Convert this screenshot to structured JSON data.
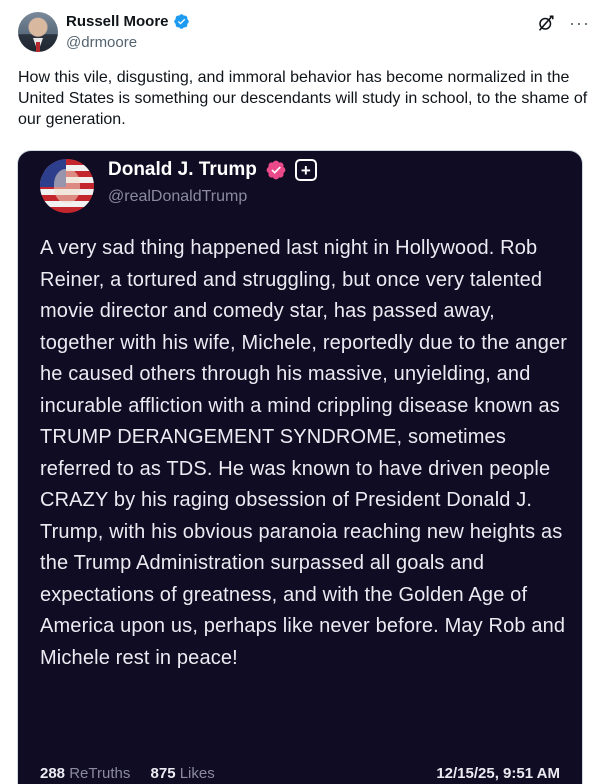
{
  "author": {
    "name": "Russell Moore",
    "handle": "@drmoore",
    "avatar_icon": "profile-photo",
    "verified_icon": "verified-badge-icon",
    "verified_color": "#1d9bf0"
  },
  "actions": {
    "grok_icon": "grok-icon",
    "more_label": "···"
  },
  "tweet": {
    "text": "How this vile, disgusting, and immoral behavior has become normalized in the United States is something our descendants will study in school, to the shame of our generation."
  },
  "embedded_post": {
    "name": "Donald J. Trump",
    "handle": "@realDonaldTrump",
    "badge_color": "#ea4a8a",
    "plus_label": "+",
    "body": "A very sad thing happened last night in Hollywood. Rob Reiner, a tortured and struggling, but once very talented movie director and comedy star, has passed away, together with his wife, Michele, reportedly due to the anger he caused others through his massive, unyielding, and incurable affliction with a mind crippling disease known as TRUMP DERANGEMENT SYNDROME, sometimes referred to as TDS. He was known to have driven people CRAZY by his raging obsession of President Donald J. Trump, with his obvious paranoia reaching new heights as the Trump Administration surpassed all goals and expectations of greatness, and with the Golden Age of America upon us, perhaps like never before. May Rob and Michele rest in peace!",
    "retruths_count": "288",
    "retruths_label": "ReTruths",
    "likes_count": "875",
    "likes_label": "Likes",
    "timestamp": "12/15/25, 9:51 AM",
    "background_color": "#0f0c24"
  }
}
